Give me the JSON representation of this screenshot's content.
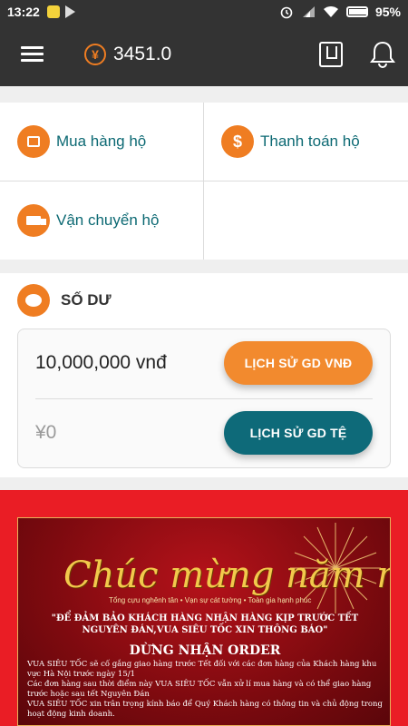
{
  "status_bar": {
    "time": "13:22",
    "battery": "95%"
  },
  "app_bar": {
    "currency_symbol": "¥",
    "balance": "3451.0"
  },
  "services": [
    {
      "label": "Mua hàng hộ",
      "icon": "store-icon"
    },
    {
      "label": "Thanh toán hộ",
      "icon": "dollar-icon"
    },
    {
      "label": "Vận chuyển hộ",
      "icon": "truck-icon"
    }
  ],
  "balance_section": {
    "title": "SỐ DƯ",
    "vnd_amount": "10,000,000 vnđ",
    "vnd_button": "LỊCH SỬ GD VNĐ",
    "cny_amount": "¥0",
    "cny_button": "LỊCH SỬ GD TỆ"
  },
  "banner": {
    "title": "Chúc mừng năm mới!",
    "subtitle": "Tổng cựu nghênh tân  •  Vạn sự cát tường  •  Toàn gia hạnh phúc",
    "quote": "\"ĐỂ ĐẢM BẢO KHÁCH HÀNG NHẬN HÀNG KỊP TRƯỚC TẾT NGUYÊN ĐÁN,VUA SIÊU TỐC XIN THÔNG BÁO\"",
    "headline": "DỪNG NHẬN ORDER",
    "body_1": "VUA SIÊU TỐC sẽ cố gắng giao hàng trước Tết đối với các đơn hàng của Khách hàng khu vực Hà Nội trước ngày 15/1",
    "body_2": "Các đơn hàng sau thời điểm này VUA SIÊU TỐC vẫn xử lí mua hàng và có thể giao hàng trước hoặc sau tết Nguyên Đán",
    "body_3": "VUA SIÊU TỐC xin trân trọng kính báo để Quý Khách hàng có thông tin và chủ động trong hoạt động kinh doanh."
  },
  "colors": {
    "accent": "#ef7d22",
    "teal": "#0e6a79",
    "app_bar": "#333333",
    "banner_red": "#ea1d25"
  }
}
